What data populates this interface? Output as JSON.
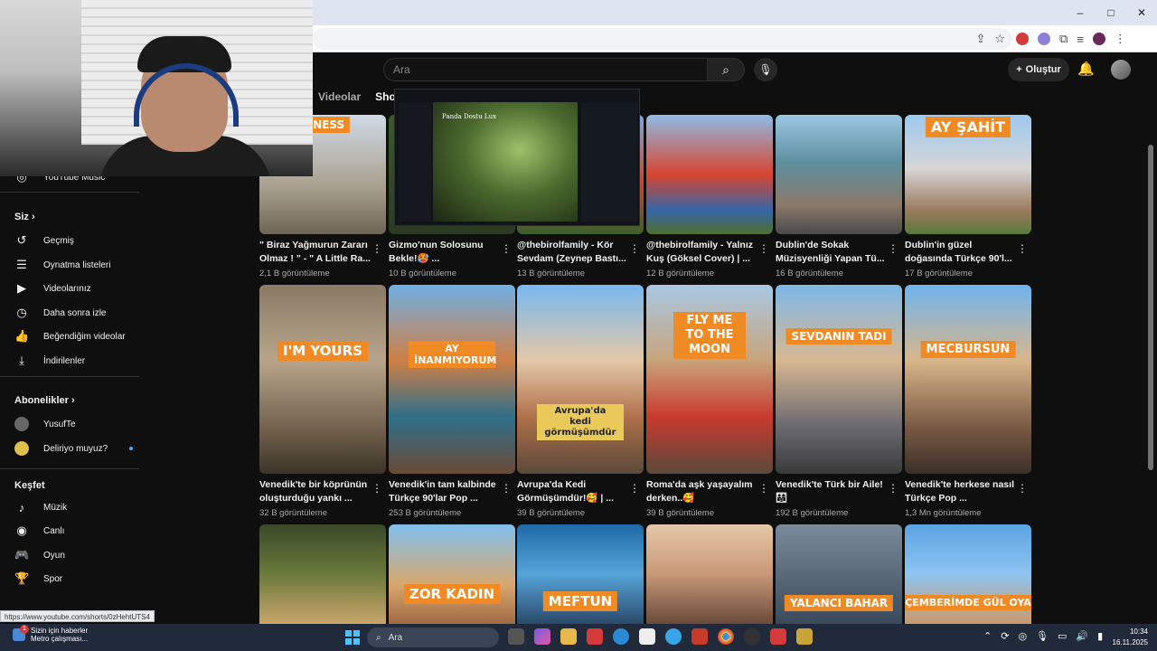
{
  "browser": {
    "window_controls": [
      "–",
      "□",
      "✕"
    ]
  },
  "header": {
    "search_placeholder": "Ara",
    "create_label": "Oluştur"
  },
  "tabs": [
    {
      "label": "Videolar",
      "active": false
    },
    {
      "label": "Shorts",
      "active": true
    }
  ],
  "sidebar": {
    "youtube_music": "YouTube Music",
    "you_heading": "Siz",
    "you_items": [
      {
        "label": "Geçmiş",
        "icon": "history-icon"
      },
      {
        "label": "Oynatma listeleri",
        "icon": "playlist-icon"
      },
      {
        "label": "Videolarınız",
        "icon": "your-videos-icon"
      },
      {
        "label": "Daha sonra izle",
        "icon": "watch-later-icon"
      },
      {
        "label": "Beğendiğim videolar",
        "icon": "like-icon"
      },
      {
        "label": "İndirilenler",
        "icon": "download-icon"
      }
    ],
    "subs_heading": "Abonelikler",
    "subs_items": [
      {
        "label": "YusufTe"
      },
      {
        "label": "Deliriyo muyuz?"
      }
    ],
    "explore_heading": "Keşfet",
    "explore_items": [
      {
        "label": "Müzik",
        "icon": "music-icon"
      },
      {
        "label": "Canlı",
        "icon": "live-icon"
      },
      {
        "label": "Oyun",
        "icon": "gaming-icon"
      },
      {
        "label": "Spor",
        "icon": "trophy-icon"
      }
    ]
  },
  "popup": {
    "title": "Panda Dostu Lux"
  },
  "grid": {
    "row1": [
      {
        "overlay": "PINESS",
        "title_line1": "\" Biraz Yağmurun Zararı",
        "title_line2": "Olmaz ! \" - \" A Little Ra...",
        "views": "2,1 B görüntüleme"
      },
      {
        "overlay": "",
        "title_line1": "Gizmo'nun Solosunu",
        "title_line2": "Bekle!🥵 ...",
        "views": "10 B görüntüleme"
      },
      {
        "overlay": "",
        "title_line1": "@thebirolfamily - Kör",
        "title_line2": "Sevdam (Zeynep Bastı...",
        "views": "13 B görüntüleme"
      },
      {
        "overlay": "",
        "title_line1": "@thebirolfamily - Yalnız",
        "title_line2": "Kuş (Göksel Cover) | ...",
        "views": "12 B görüntüleme"
      },
      {
        "overlay": "",
        "title_line1": "Dublin'de Sokak",
        "title_line2": "Müzisyenliği Yapan Tü...",
        "views": "16 B görüntüleme"
      },
      {
        "overlay": "AY ŞAHİT",
        "title_line1": "Dublin'in güzel",
        "title_line2": "doğasında Türkçe 90'l...",
        "views": "17 B görüntüleme"
      }
    ],
    "row2": [
      {
        "overlay": "I'M YOURS",
        "title_line1": "Venedik'te bir köprünün",
        "title_line2": "oluşturduğu yankı ...",
        "views": "32 B görüntüleme"
      },
      {
        "overlay": "AY İNANMIYORUM",
        "title_line1": "Venedik'in tam kalbinde",
        "title_line2": "Türkçe 90'lar Pop ...",
        "views": "253 B görüntüleme"
      },
      {
        "overlay": "Avrupa'da kedi görmüşümdür",
        "title_line1": "Avrupa'da Kedi",
        "title_line2": "Görmüşümdür!🥰 | ...",
        "views": "39 B görüntüleme"
      },
      {
        "overlay": "FLY ME TO THE MOON",
        "title_line1": "Roma'da aşk yaşayalım",
        "title_line2": "derken..🥰",
        "views": "39 B görüntüleme"
      },
      {
        "overlay": "SEVDANIN TADI",
        "title_line1": "Venedik'te Türk bir Aile!",
        "title_line2": "👨‍👩‍👧",
        "views": "192 B görüntüleme"
      },
      {
        "overlay": "MECBURSUN",
        "title_line1": "Venedik'te herkese nasıl",
        "title_line2": "Türkçe Pop ...",
        "views": "1,3 Mn görüntüleme"
      }
    ],
    "row3": [
      {
        "overlay": ""
      },
      {
        "overlay": "ZOR KADIN"
      },
      {
        "overlay": "MEFTUN"
      },
      {
        "overlay": ""
      },
      {
        "overlay": "YALANCI BAHAR"
      },
      {
        "overlay": "ÇEMBERİMDE GÜL OYA"
      }
    ]
  },
  "status_url": "https://www.youtube.com/shorts/0zHehtUTS4",
  "taskbar": {
    "news_title": "Sizin için haberler",
    "news_subtitle": "Metro çalışması...",
    "news_badge": "1",
    "search_placeholder": "Ara",
    "time": "10:34",
    "date": "16.11.2025"
  }
}
